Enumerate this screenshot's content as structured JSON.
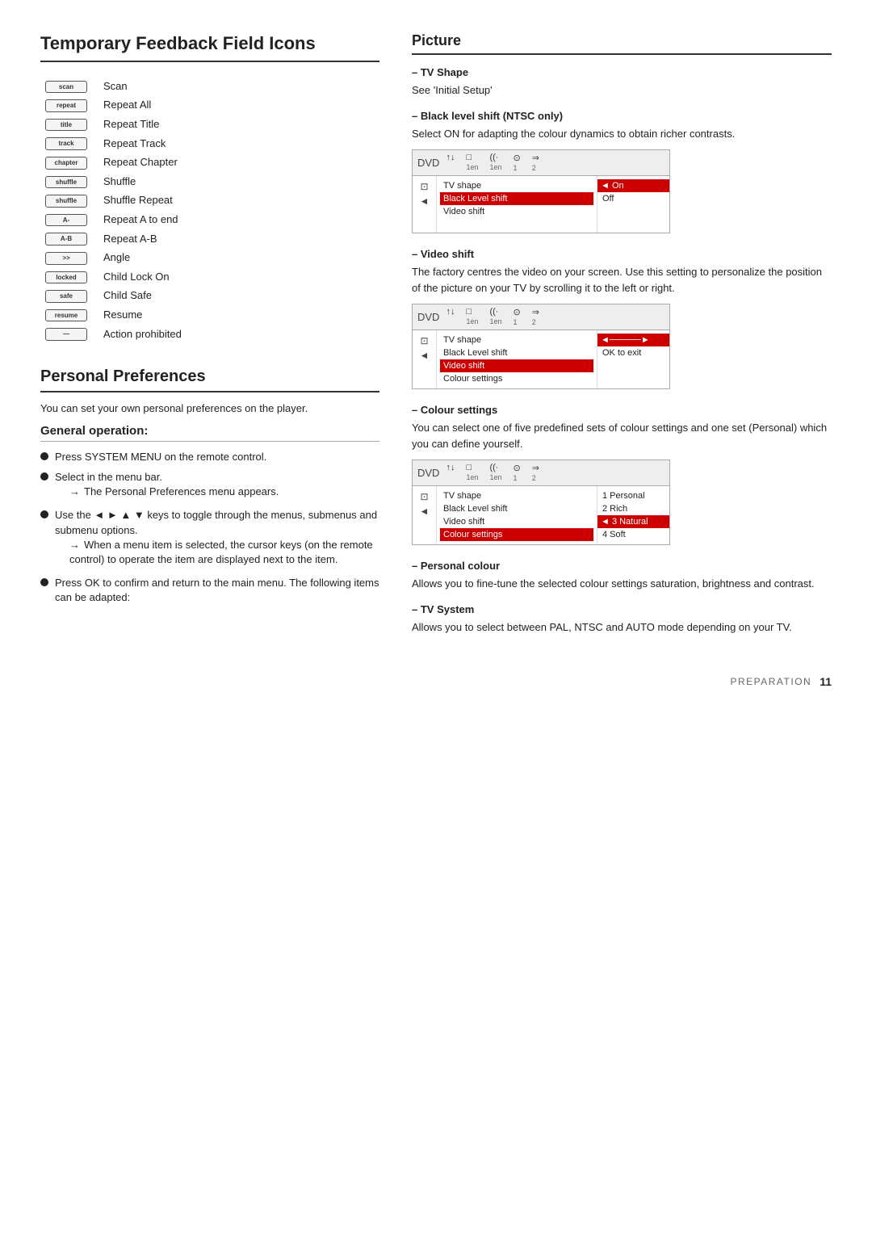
{
  "left": {
    "section1_title": "Temporary Feedback Field Icons",
    "icons": [
      {
        "badge_top": "scan",
        "badge_bottom": "",
        "label": "Scan"
      },
      {
        "badge_top": "repeat",
        "badge_bottom": "",
        "label": "Repeat All"
      },
      {
        "badge_top": "title",
        "badge_bottom": "",
        "label": "Repeat Title"
      },
      {
        "badge_top": "track",
        "badge_bottom": "",
        "label": "Repeat Track"
      },
      {
        "badge_top": "chapter",
        "badge_bottom": "",
        "label": "Repeat Chapter"
      },
      {
        "badge_top": "shuffle",
        "badge_bottom": "",
        "label": "Shuffle"
      },
      {
        "badge_top": "shuffle",
        "badge_bottom": "",
        "label": "Shuffle Repeat"
      },
      {
        "badge_top": "A-",
        "badge_bottom": "",
        "label": "Repeat A to end"
      },
      {
        "badge_top": "A-B",
        "badge_bottom": "",
        "label": "Repeat A-B"
      },
      {
        "badge_top": ">>",
        "badge_bottom": "",
        "label": "Angle"
      },
      {
        "badge_top": "locked",
        "badge_bottom": "",
        "label": "Child Lock On"
      },
      {
        "badge_top": "safe",
        "badge_bottom": "",
        "label": "Child Safe"
      },
      {
        "badge_top": "resume",
        "badge_bottom": "",
        "label": "Resume"
      },
      {
        "badge_top": "—",
        "badge_bottom": "",
        "label": "Action prohibited"
      }
    ],
    "section2_title": "Personal Preferences",
    "prefs_intro": "You can set your own personal preferences on the player.",
    "general_op_title": "General operation:",
    "bullets": [
      {
        "text": "Press SYSTEM MENU on the remote control."
      },
      {
        "text": "Select  in the menu bar.",
        "sub": "→ The Personal Preferences menu appears."
      },
      {
        "text": "Use the ◄ ► ▲ ▼ keys to toggle through the menus, submenus and submenu options.",
        "sub": "→ When a menu item is selected, the cursor keys (on the remote control) to operate the item are displayed next to the item."
      },
      {
        "text": "Press OK to confirm and return to the main menu. The following items can be adapted:"
      }
    ]
  },
  "right": {
    "section_title": "Picture",
    "subsections": [
      {
        "dash_label": "– TV Shape",
        "body": "See 'Initial Setup'"
      },
      {
        "dash_label": "– Black level shift (NTSC only)",
        "body": "Select ON for adapting the colour dynamics to obtain richer contrasts.",
        "osd": {
          "topbar_items": [
            "↑↓",
            "□",
            "((·",
            "⊙",
            "⇒"
          ],
          "topbar_sub": [
            "",
            "1en",
            "1en",
            "1",
            "2"
          ],
          "left_icons": [
            "⊡",
            "◄"
          ],
          "menu_rows": [
            {
              "label": "TV shape",
              "highlighted": false
            },
            {
              "label": "Black Level shift",
              "highlighted": true
            },
            {
              "label": "Video shift",
              "highlighted": false
            }
          ],
          "value_col": [
            {
              "val": "◄ On",
              "highlighted": true
            },
            {
              "val": "Off",
              "highlighted": false
            }
          ]
        }
      },
      {
        "dash_label": "– Video shift",
        "body": "The factory centres the video on your screen. Use this setting to personalize the position of the picture on your TV by scrolling it to the left or right.",
        "osd": {
          "topbar_items": [
            "↑↓",
            "□",
            "((·",
            "⊙",
            "⇒"
          ],
          "topbar_sub": [
            "",
            "1en",
            "1en",
            "1",
            "2"
          ],
          "left_icons": [
            "⊡",
            "◄"
          ],
          "menu_rows": [
            {
              "label": "TV shape",
              "highlighted": false
            },
            {
              "label": "Black Level shift",
              "highlighted": false
            },
            {
              "label": "Video shift",
              "highlighted": true
            },
            {
              "label": "Colour settings",
              "highlighted": false
            }
          ],
          "value_col": [
            {
              "val": "◄─────►",
              "highlighted": true
            },
            {
              "val": "OK to exit",
              "highlighted": false
            }
          ]
        }
      },
      {
        "dash_label": "– Colour settings",
        "body": "You can select one of five predefined sets of colour settings and one set (Personal) which you can define yourself.",
        "osd": {
          "topbar_items": [
            "↑↓",
            "□",
            "((·",
            "⊙",
            "⇒"
          ],
          "topbar_sub": [
            "",
            "1en",
            "1en",
            "1",
            "2"
          ],
          "left_icons": [
            "⊡",
            "◄"
          ],
          "menu_rows": [
            {
              "label": "TV shape",
              "highlighted": false
            },
            {
              "label": "Black Level shift",
              "highlighted": false
            },
            {
              "label": "Video shift",
              "highlighted": false
            },
            {
              "label": "Colour settings",
              "highlighted": true
            }
          ],
          "value_col": [
            {
              "val": "1 Personal",
              "highlighted": false
            },
            {
              "val": "2 Rich",
              "highlighted": false
            },
            {
              "val": "◄ 3 Natural",
              "highlighted": true
            },
            {
              "val": "4 Soft",
              "highlighted": false
            }
          ]
        }
      },
      {
        "dash_label": "– Personal colour",
        "body": "Allows you to fine-tune the selected colour settings saturation, brightness and contrast."
      },
      {
        "dash_label": "– TV System",
        "body": "Allows you to select between PAL, NTSC and AUTO mode depending on your TV."
      }
    ]
  },
  "footer": {
    "prep_label": "Preparation",
    "page_num": "11"
  }
}
